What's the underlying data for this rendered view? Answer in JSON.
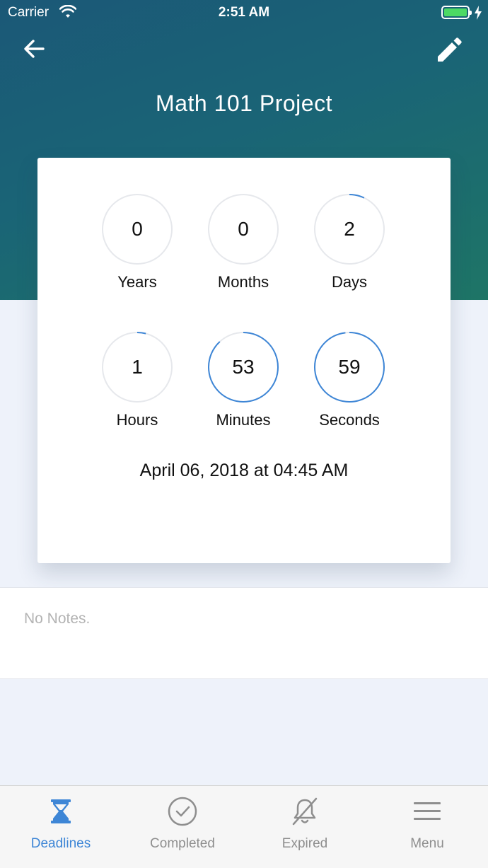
{
  "status_bar": {
    "carrier": "Carrier",
    "time": "2:51 AM",
    "battery_color": "#4cd964"
  },
  "header": {
    "title": "Math 101 Project",
    "back_icon": "arrow-left-icon",
    "edit_icon": "pencil-icon"
  },
  "countdown": {
    "units": [
      {
        "value": "0",
        "label": "Years",
        "fraction": 0.0
      },
      {
        "value": "0",
        "label": "Months",
        "fraction": 0.0
      },
      {
        "value": "2",
        "label": "Days",
        "fraction": 0.07
      },
      {
        "value": "1",
        "label": "Hours",
        "fraction": 0.04
      },
      {
        "value": "53",
        "label": "Minutes",
        "fraction": 0.88
      },
      {
        "value": "59",
        "label": "Seconds",
        "fraction": 0.98
      }
    ],
    "ring_color": "#3e86d6",
    "track_color": "#e6e8ec",
    "deadline": "April 06, 2018 at 04:45 AM"
  },
  "notes": {
    "text": "No Notes."
  },
  "tabs": [
    {
      "label": "Deadlines",
      "icon": "hourglass-icon",
      "active": true
    },
    {
      "label": "Completed",
      "icon": "check-circle-icon",
      "active": false
    },
    {
      "label": "Expired",
      "icon": "bell-off-icon",
      "active": false
    },
    {
      "label": "Menu",
      "icon": "hamburger-icon",
      "active": false
    }
  ],
  "colors": {
    "accent": "#3e86d6",
    "inactive": "#8e8e8e"
  }
}
